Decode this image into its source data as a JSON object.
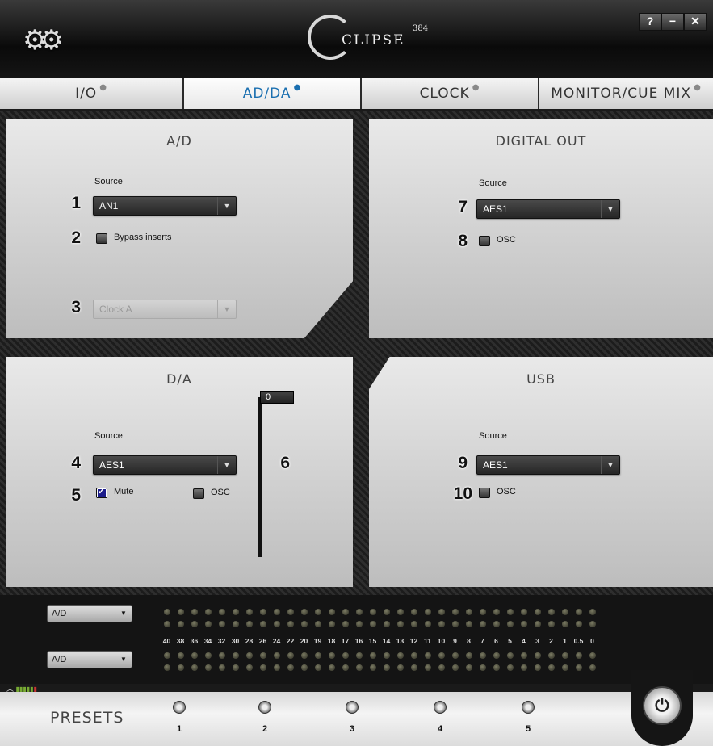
{
  "app": {
    "brand": "CLIPSE",
    "brand_sup": "384"
  },
  "window": {
    "help": "?",
    "minimize": "−",
    "close": "✕"
  },
  "tabs": [
    {
      "label": "I/O",
      "active": false
    },
    {
      "label": "AD/DA",
      "active": true
    },
    {
      "label": "CLOCK",
      "active": false
    },
    {
      "label": "MONITOR/CUE MIX",
      "active": false
    }
  ],
  "ad": {
    "title": "A/D",
    "source_label": "Source",
    "source_value": "AN1",
    "bypass_label": "Bypass inserts",
    "bypass_checked": false,
    "clock_value": "Clock A",
    "num_source": "1",
    "num_bypass": "2",
    "num_clock": "3"
  },
  "digital_out": {
    "title": "DIGITAL OUT",
    "source_label": "Source",
    "source_value": "AES1",
    "osc_label": "OSC",
    "num_source": "7",
    "num_osc": "8"
  },
  "da": {
    "title": "D/A",
    "source_label": "Source",
    "source_value": "AES1",
    "mute_label": "Mute",
    "mute_checked": true,
    "osc_label": "OSC",
    "fader_value": "0",
    "num_source": "4",
    "num_mute": "5",
    "num_fader": "6"
  },
  "usb": {
    "title": "USB",
    "source_label": "Source",
    "source_value": "AES1",
    "osc_label": "OSC",
    "num_source": "9",
    "num_osc": "10"
  },
  "meter": {
    "select_top": "A/D",
    "select_bottom": "A/D",
    "scale": [
      "40",
      "38",
      "36",
      "34",
      "32",
      "30",
      "28",
      "26",
      "24",
      "22",
      "20",
      "19",
      "18",
      "17",
      "16",
      "15",
      "14",
      "13",
      "12",
      "11",
      "10",
      "9",
      "8",
      "7",
      "6",
      "5",
      "4",
      "3",
      "2",
      "1",
      "0.5",
      "0"
    ]
  },
  "presets": {
    "label": "PRESETS",
    "items": [
      "1",
      "2",
      "3",
      "4",
      "5"
    ]
  },
  "colors": {
    "accent": "#1a6fb0",
    "panel": "#d6d6d6",
    "dark": "#1a1a1a"
  }
}
